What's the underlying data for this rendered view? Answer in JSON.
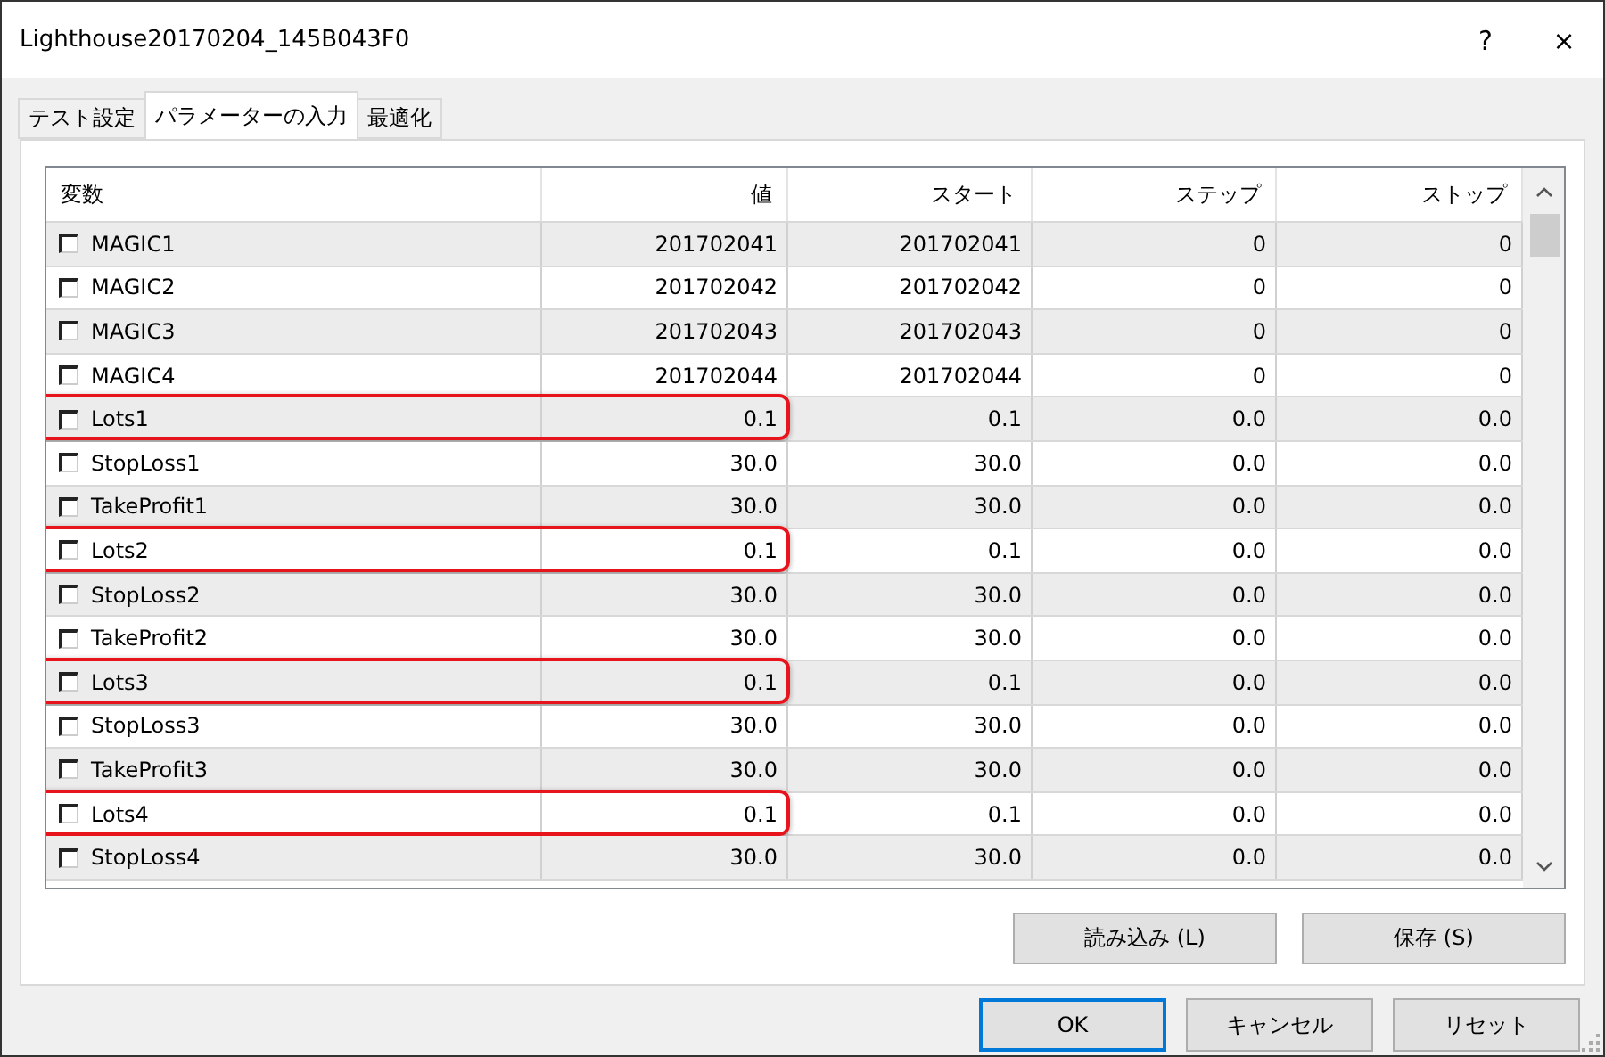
{
  "window": {
    "title": "Lighthouse20170204_145B043F0",
    "buttons": [
      "?",
      "×"
    ]
  },
  "tabs": [
    {
      "label": "テスト設定",
      "selected": false
    },
    {
      "label": "パラメーターの入力",
      "selected": true
    },
    {
      "label": "最適化",
      "selected": false
    }
  ],
  "table": {
    "columns": [
      "変数",
      "値",
      "スタート",
      "ステップ",
      "ストップ"
    ],
    "rows": [
      {
        "name": "MAGIC1",
        "value": "201702041",
        "start": "201702041",
        "step": "0",
        "stop": "0",
        "checked": false,
        "highlighted": false
      },
      {
        "name": "MAGIC2",
        "value": "201702042",
        "start": "201702042",
        "step": "0",
        "stop": "0",
        "checked": false,
        "highlighted": false
      },
      {
        "name": "MAGIC3",
        "value": "201702043",
        "start": "201702043",
        "step": "0",
        "stop": "0",
        "checked": false,
        "highlighted": false
      },
      {
        "name": "MAGIC4",
        "value": "201702044",
        "start": "201702044",
        "step": "0",
        "stop": "0",
        "checked": false,
        "highlighted": false
      },
      {
        "name": "Lots1",
        "value": "0.1",
        "start": "0.1",
        "step": "0.0",
        "stop": "0.0",
        "checked": false,
        "highlighted": true
      },
      {
        "name": "StopLoss1",
        "value": "30.0",
        "start": "30.0",
        "step": "0.0",
        "stop": "0.0",
        "checked": false,
        "highlighted": false
      },
      {
        "name": "TakeProfit1",
        "value": "30.0",
        "start": "30.0",
        "step": "0.0",
        "stop": "0.0",
        "checked": false,
        "highlighted": false
      },
      {
        "name": "Lots2",
        "value": "0.1",
        "start": "0.1",
        "step": "0.0",
        "stop": "0.0",
        "checked": false,
        "highlighted": true
      },
      {
        "name": "StopLoss2",
        "value": "30.0",
        "start": "30.0",
        "step": "0.0",
        "stop": "0.0",
        "checked": false,
        "highlighted": false
      },
      {
        "name": "TakeProfit2",
        "value": "30.0",
        "start": "30.0",
        "step": "0.0",
        "stop": "0.0",
        "checked": false,
        "highlighted": false
      },
      {
        "name": "Lots3",
        "value": "0.1",
        "start": "0.1",
        "step": "0.0",
        "stop": "0.0",
        "checked": false,
        "highlighted": true
      },
      {
        "name": "StopLoss3",
        "value": "30.0",
        "start": "30.0",
        "step": "0.0",
        "stop": "0.0",
        "checked": false,
        "highlighted": false
      },
      {
        "name": "TakeProfit3",
        "value": "30.0",
        "start": "30.0",
        "step": "0.0",
        "stop": "0.0",
        "checked": false,
        "highlighted": false
      },
      {
        "name": "Lots4",
        "value": "0.1",
        "start": "0.1",
        "step": "0.0",
        "stop": "0.0",
        "checked": false,
        "highlighted": true
      },
      {
        "name": "StopLoss4",
        "value": "30.0",
        "start": "30.0",
        "step": "0.0",
        "stop": "0.0",
        "checked": false,
        "highlighted": false
      }
    ]
  },
  "panel_buttons": [
    "読み込み (L)",
    "保存 (S)"
  ],
  "dialog_buttons": [
    {
      "label": "OK",
      "default": true
    },
    {
      "label": "キャンセル",
      "default": false
    },
    {
      "label": "リセット",
      "default": false
    }
  ]
}
